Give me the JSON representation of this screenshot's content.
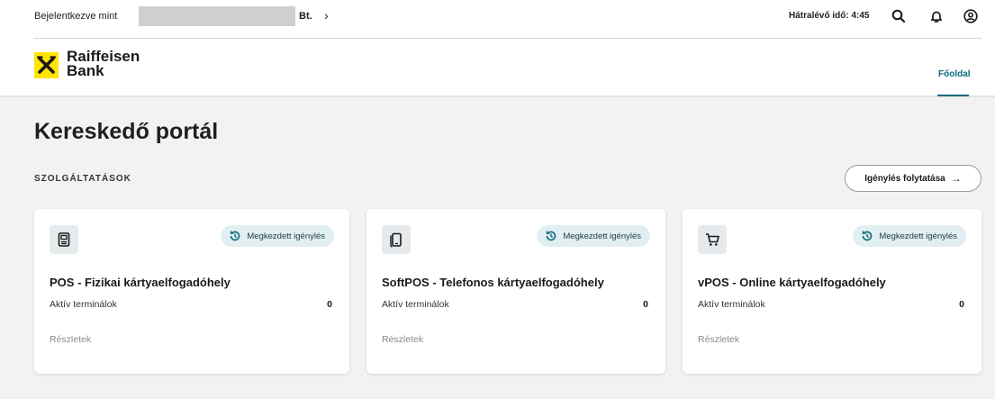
{
  "topbar": {
    "login_label": "Bejelentkezve mint",
    "company_suffix": "Bt.",
    "chevron": "›",
    "timer": "Hátralévő idő: 4:45",
    "icons": [
      "search-icon",
      "bell-icon",
      "user-icon"
    ]
  },
  "brand": {
    "line1": "Raiffeisen",
    "line2": "Bank",
    "colors": {
      "logo_yellow": "#fee600",
      "accent": "#0a6b7a"
    }
  },
  "nav": {
    "home": "Főoldal"
  },
  "main": {
    "title": "Kereskedő portál",
    "section": "SZOLGÁLTATÁSOK",
    "continue_button": "Igénylés folytatása",
    "continue_arrow": "→"
  },
  "cards": [
    {
      "icon": "pos-terminal-icon",
      "status": "Megkezdett igénylés",
      "title": "POS - Fizikai kártyaelfogadóhely",
      "sub": "Aktív terminálok",
      "count": "0",
      "link": "Részletek"
    },
    {
      "icon": "phone-icon",
      "status": "Megkezdett igénylés",
      "title": "SoftPOS - Telefonos kártyaelfogadóhely",
      "sub": "Aktív terminálok",
      "count": "0",
      "link": "Részletek"
    },
    {
      "icon": "cart-icon",
      "status": "Megkezdett igénylés",
      "title": "vPOS - Online kártyaelfogadóhely",
      "sub": "Aktív terminálok",
      "count": "0",
      "link": "Részletek"
    }
  ]
}
